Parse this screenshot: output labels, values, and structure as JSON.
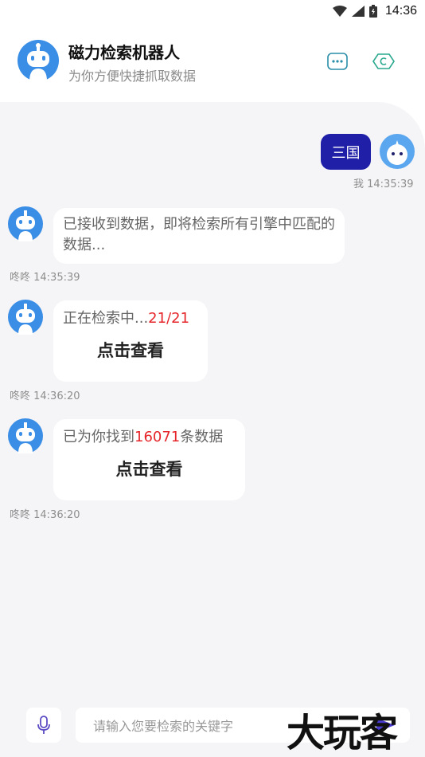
{
  "status_bar": {
    "time": "14:36"
  },
  "header": {
    "title": "磁力检索机器人",
    "subtitle": "为你方便快捷抓取数据",
    "more_icon": "more-dots-icon",
    "clean_icon": "clean-icon"
  },
  "messages": {
    "user": {
      "text": "三国",
      "timestamp": "我 14:35:39"
    },
    "bot1": {
      "text": "已接收到数据，即将检索所有引擎中匹配的数据...",
      "timestamp": "咚咚 14:35:39"
    },
    "bot2": {
      "prefix": "正在检索中...",
      "progress": "21/21",
      "action": "点击查看",
      "timestamp": "咚咚 14:36:20"
    },
    "bot3": {
      "prefix": "已为你找到",
      "count": "16071",
      "suffix": "条数据",
      "action": "点击查看",
      "timestamp": "咚咚 14:36:20"
    }
  },
  "input": {
    "placeholder": "请输入您要检索的关键字"
  },
  "watermark": "大玩客",
  "colors": {
    "accent": "#1f1fa8",
    "highlight": "#e5252a",
    "avatar_blue": "#3a8ee6"
  }
}
